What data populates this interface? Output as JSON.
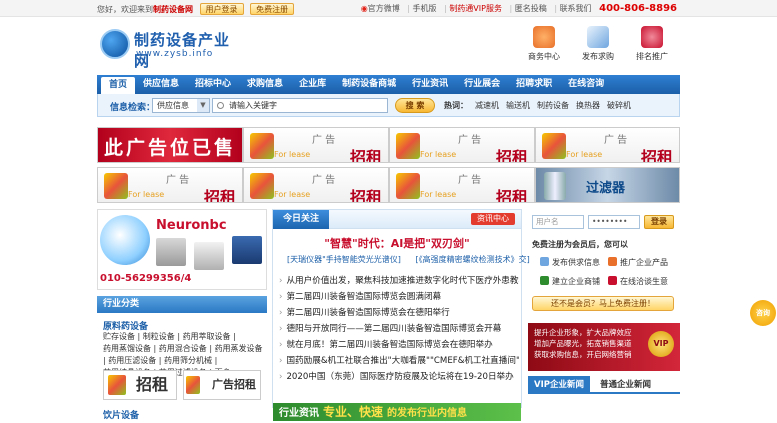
{
  "topbar": {
    "welcome": "您好，欢迎来到",
    "site_name": "制药设备网",
    "login": "用户登录",
    "register": "免费注册",
    "weibo": "官方微博",
    "mobile": "手机版",
    "vip": "制药通VIP服务",
    "anon": "匿名投稿",
    "contact": "联系我们",
    "phone": "400-806-8896"
  },
  "logo": {
    "cn": "制药设备产业网",
    "en": "www.zysb.info"
  },
  "quick": [
    {
      "label": "商务中心",
      "icon": "business-center-icon",
      "color": "#e8702a"
    },
    {
      "label": "发布求购",
      "icon": "post-purchase-icon",
      "color": "#2b78c4"
    },
    {
      "label": "排名推广",
      "icon": "ranking-promo-icon",
      "color": "#c8102e"
    }
  ],
  "nav": [
    "首页",
    "供应信息",
    "招标中心",
    "求购信息",
    "企业库",
    "制药设备商城",
    "行业资讯",
    "行业展会",
    "招聘求职",
    "在线咨询"
  ],
  "search": {
    "label": "信息检索：",
    "category": "供应信息",
    "placeholder": "请输入关键字",
    "button": "搜 索",
    "hot_label": "热词：",
    "hot": [
      "减速机",
      "输送机",
      "制药设备",
      "换热器",
      "破碎机"
    ]
  },
  "ads": {
    "sold": "此广告位已售",
    "rent_top": "广 告",
    "rent_for": "For lease",
    "rent_big": "招租",
    "filter": "过滤器"
  },
  "neuron": {
    "brand": "Neuronbc",
    "phone": "010-56299356/4"
  },
  "sidebar": {
    "title": "行业分类",
    "cat1": "原料药设备",
    "items": [
      "贮存设备",
      "制粒设备",
      "药用萃取设备",
      "药用蒸馏设备",
      "药用混合设备",
      "药用蒸发设备",
      "药用压滤设备",
      "药用筛分机械",
      "药用结晶设备",
      "药用过滤设备",
      "更多"
    ],
    "ad_zu": "招租",
    "ad_gg": "广告招租",
    "cat2": "饮片设备"
  },
  "focus": {
    "tab": "今日关注",
    "more": "资讯中心",
    "headline": "\"智慧\"时代：AI是把\"双刃剑\"",
    "subs": [
      "[天瑞仪器\"手持智能荧光光谱仪]",
      "[《高强度精密螺纹检测技术》交]"
    ],
    "list": [
      "从用户价值出发，聚焦科技加速推进数字化时代下医疗外患教科",
      "第二届四川装备智造国际博览会圆满闭幕",
      "第二届四川装备智造国际博览会在德阳举行",
      "德阳与开放同行——第二届四川装备智造国际博览会开幕",
      "就在月底！第二届四川装备智造国际博览会在德阳举办",
      "国药励展&机工社联合推出\"大咖看展\"\"CMEF&机工社直播间\"",
      "2020中国（东莞）国际医疗防疫展及论坛将在19-20日举办"
    ],
    "banner_a": "行业资讯",
    "banner_b": "专业、快速",
    "banner_c": "的发布行业内信息"
  },
  "login": {
    "user_ph": "用户名",
    "pass_value": "••••••••",
    "btn": "登录",
    "free": "免费注册为会员后，您可以",
    "f1": "发布供求信息",
    "f2": "推广企业产品",
    "f3": "建立企业商铺",
    "f4": "在线洽谈生意",
    "noreg": "还不是会员？马上免费注册！"
  },
  "vip": {
    "l1": "提升企业形象，扩大品牌效应",
    "l2": "增加产品曝光，拓宽销售渠道",
    "l3": "获取求购信息，开启网络营销",
    "badge": "VIP"
  },
  "news_tabs": {
    "a": "VIP企业新闻",
    "b": "普通企业新闻"
  },
  "float": "咨询"
}
